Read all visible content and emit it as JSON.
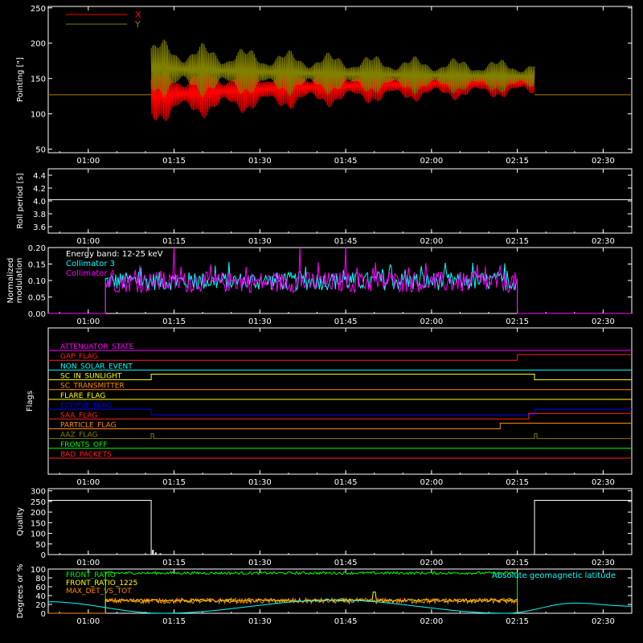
{
  "colors": {
    "background": "#000000",
    "axis": "#ffffff",
    "x": "#ff0000",
    "y": "#808000",
    "white": "#ffffff",
    "cyan": "#00ffff",
    "magenta": "#ff00ff",
    "green": "#00ff00",
    "yellow": "#ffff00",
    "orange": "#ff8c00",
    "blue": "#0000ff",
    "red": "#ff2020"
  },
  "time_ticks": [
    "01:00",
    "01:15",
    "01:30",
    "01:45",
    "02:00",
    "02:15",
    "02:30"
  ],
  "time_range": [
    "00:53",
    "02:35"
  ],
  "chart_data": [
    {
      "type": "line",
      "ylabel": "Pointing [\"]",
      "ylim": [
        45,
        252
      ],
      "yticks": [
        50,
        100,
        150,
        200,
        250
      ],
      "legend": {
        "placement": "top-left",
        "entries": [
          "X",
          "Y"
        ]
      },
      "series": [
        {
          "name": "X",
          "color": "#ff0000",
          "baseline": 127,
          "oscillation": {
            "start": "01:11",
            "end": "02:18",
            "center": 125,
            "center_end": 150,
            "amp_start": 55,
            "amp_end": 25,
            "amp_decay_min": 40
          }
        },
        {
          "name": "Y",
          "color": "#808000",
          "baseline": 127,
          "oscillation": {
            "start": "01:11",
            "end": "02:18",
            "center": 165,
            "center_end": 150,
            "amp_start": 58,
            "amp_end": 26,
            "amp_decay_min": 40
          }
        }
      ]
    },
    {
      "type": "line",
      "ylabel": "Roll period [s]",
      "ylim": [
        3.5,
        4.5
      ],
      "yticks": [
        3.6,
        3.8,
        4.0,
        4.2,
        4.4
      ],
      "yticklabels": [
        "3.6",
        "3.8",
        "4.0",
        "4.2",
        "4.4"
      ],
      "series": [
        {
          "color": "#ffffff",
          "x": [
            "00:53",
            "02:35"
          ],
          "y": [
            4.02,
            4.02
          ]
        }
      ]
    },
    {
      "type": "line",
      "ylabel": "Normalized modulation",
      "ylim": [
        0,
        0.2
      ],
      "yticks": [
        0,
        0.05,
        0.1,
        0.15,
        0.2
      ],
      "yticklabels": [
        "0.00",
        "0.05",
        "0.10",
        "0.15",
        "0.20"
      ],
      "annotation": "Energy band: 12-25 keV",
      "legend": {
        "placement": "top-left",
        "entries": [
          "Collimator 3",
          "Collimator 4"
        ]
      },
      "series": [
        {
          "name": "Collimator 3",
          "color": "#00ffff",
          "active": [
            "01:03",
            "02:15"
          ],
          "mean": 0.098,
          "spread": 0.04
        },
        {
          "name": "Collimator 4",
          "color": "#ff00ff",
          "active": [
            "01:03",
            "02:15"
          ],
          "mean": 0.095,
          "spread": 0.045,
          "spikes": [
            [
              "01:15",
              0.2
            ],
            [
              "01:37",
              0.2
            ],
            [
              "01:45",
              0.2
            ]
          ]
        }
      ]
    },
    {
      "type": "line",
      "ylabel": "Flags",
      "flags": [
        {
          "name": "ATTENUATOR_STATE",
          "color": "#ff00ff",
          "steps": []
        },
        {
          "name": "GAP_FLAG",
          "color": "#ff2020",
          "steps": [
            [
              "02:15",
              1
            ]
          ]
        },
        {
          "name": "NON_SOLAR_EVENT",
          "color": "#00ffff",
          "steps": []
        },
        {
          "name": "SC_IN_SUNLIGHT",
          "color": "#ffff00",
          "steps": [
            [
              "01:11",
              1
            ],
            [
              "02:18",
              0
            ]
          ]
        },
        {
          "name": "SC_TRANSMITTER",
          "color": "#ff8c00",
          "steps": []
        },
        {
          "name": "FLARE_FLAG",
          "color": "#ffff00",
          "steps": []
        },
        {
          "name": "ECLIPSE_FLAG",
          "color": "#0000ff",
          "steps": [
            [
              "01:11",
              -1
            ],
            [
              "02:18",
              0
            ]
          ]
        },
        {
          "name": "SAA_FLAG",
          "color": "#ff2020",
          "steps": [
            [
              "02:17",
              1
            ]
          ]
        },
        {
          "name": "PARTICLE_FLAG",
          "color": "#ff8c00",
          "steps": [
            [
              "02:12",
              1
            ]
          ]
        },
        {
          "name": "AAZ_FLAG",
          "color": "#808000",
          "pulses": [
            "01:11",
            "02:18"
          ]
        },
        {
          "name": "FRONTS_OFF",
          "color": "#00ff00",
          "steps": []
        },
        {
          "name": "BAD_PACKETS",
          "color": "#ff2020",
          "steps": []
        }
      ]
    },
    {
      "type": "line",
      "ylabel": "Quality",
      "ylim": [
        0,
        310
      ],
      "yticks": [
        0,
        50,
        100,
        150,
        200,
        250,
        300
      ],
      "series": [
        {
          "color": "#ffffff",
          "x": [
            "00:53",
            "01:11",
            "01:11",
            "01:12",
            "02:18",
            "02:18",
            "02:35"
          ],
          "y": [
            255,
            255,
            0,
            0,
            0,
            255,
            255
          ]
        }
      ]
    },
    {
      "type": "line",
      "ylabel": "Degrees or %",
      "ylim": [
        0,
        100
      ],
      "yticks": [
        0,
        20,
        40,
        60,
        80,
        100
      ],
      "legend": {
        "placement": "top",
        "entries": [
          "FRONT_RATIO",
          "FRONT_RATIO_1225",
          "MAX_DET_VS_TOT",
          "Absolute geomagnetic latitude"
        ]
      },
      "series": [
        {
          "name": "FRONT_RATIO",
          "color": "#00ff00",
          "active": [
            "01:03",
            "02:15"
          ],
          "mean": 91,
          "spread": 3
        },
        {
          "name": "FRONT_RATIO_1225",
          "color": "#ffff00",
          "active": [
            "01:03",
            "02:15"
          ],
          "mean": 29,
          "spread": 3
        },
        {
          "name": "MAX_DET_VS_TOT",
          "color": "#ff8c00",
          "active": [
            "01:03",
            "02:15"
          ],
          "mean": 28,
          "spread": 6
        },
        {
          "name": "Absolute geomagnetic latitude",
          "color": "#00ffff",
          "x": [
            "00:53",
            "01:13",
            "01:43",
            "02:13",
            "02:25",
            "02:35"
          ],
          "y": [
            26,
            0,
            30,
            0,
            23,
            16
          ]
        }
      ]
    }
  ]
}
